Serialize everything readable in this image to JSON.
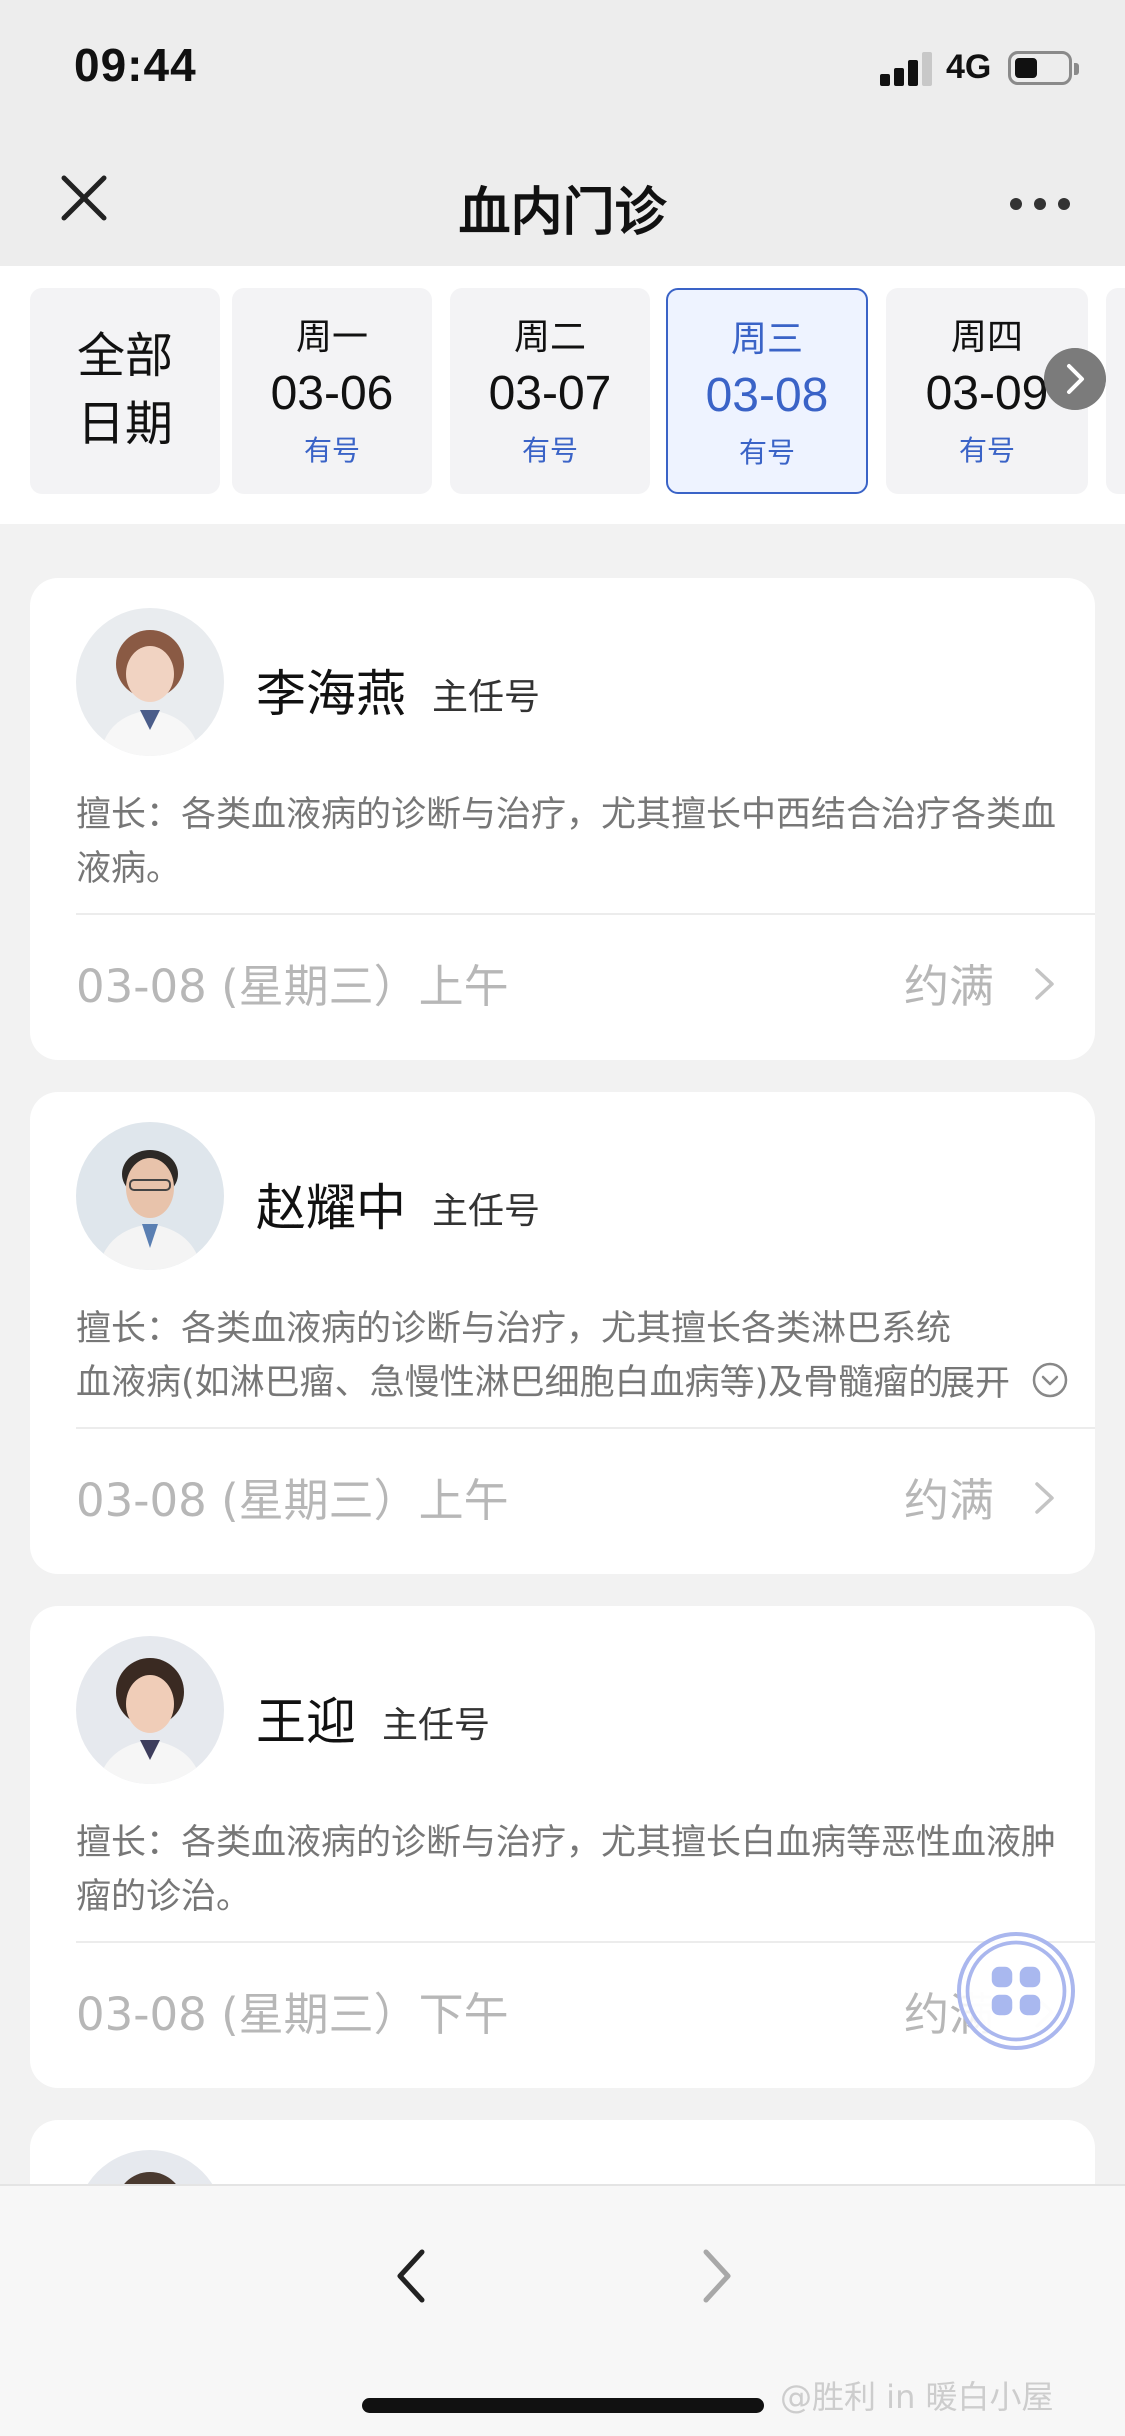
{
  "status_bar": {
    "time": "09:44",
    "network": "4G"
  },
  "nav": {
    "title": "血内门诊"
  },
  "dates": {
    "all_line1": "全部",
    "all_line2": "日期",
    "items": [
      {
        "day": "周一",
        "date": "03-06",
        "status": "有号"
      },
      {
        "day": "周二",
        "date": "03-07",
        "status": "有号"
      },
      {
        "day": "周三",
        "date": "03-08",
        "status": "有号",
        "selected": true
      },
      {
        "day": "周四",
        "date": "03-09",
        "status": "有号"
      }
    ]
  },
  "doctors": [
    {
      "name": "李海燕",
      "title": "主任号",
      "specialty": "擅长：各类血液病的诊断与治疗，尤其擅长中西结合治疗各类血液病。",
      "slot": "03-08 (星期三）上午",
      "slot_status": "约满"
    },
    {
      "name": "赵耀中",
      "title": "主任号",
      "specialty": "擅长：各类血液病的诊断与治疗，尤其擅长各类淋巴系统血液病(如淋巴瘤、急慢性淋巴细胞白血病等)及骨髓瘤的",
      "expand_label": "展开",
      "slot": "03-08 (星期三）上午",
      "slot_status": "约满"
    },
    {
      "name": "王迎",
      "title": "主任号",
      "specialty": "擅长：各类血液病的诊断与治疗，尤其擅长白血病等恶性血液肿瘤的诊治。",
      "slot": "03-08 (星期三）下午",
      "slot_status": "约满"
    }
  ],
  "watermark": "@胜利 in 暖白小屋",
  "colors": {
    "accent": "#3a63c7",
    "muted": "#b7b7b7"
  }
}
